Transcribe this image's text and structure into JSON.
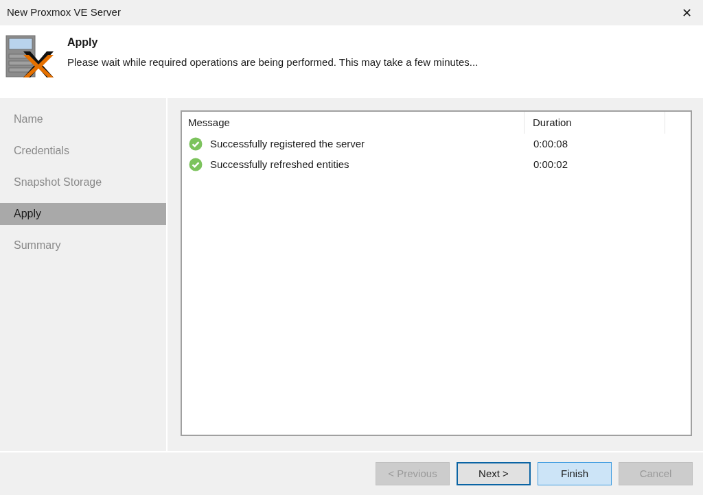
{
  "window": {
    "title": "New Proxmox VE Server",
    "close": "✕"
  },
  "header": {
    "title": "Apply",
    "description": "Please wait while required operations are being performed. This may take a few minutes..."
  },
  "sidebar": {
    "items": [
      {
        "label": "Name",
        "selected": false
      },
      {
        "label": "Credentials",
        "selected": false
      },
      {
        "label": "Snapshot Storage",
        "selected": false
      },
      {
        "label": "Apply",
        "selected": true
      },
      {
        "label": "Summary",
        "selected": false
      }
    ]
  },
  "table": {
    "columns": [
      "Message",
      "Duration"
    ],
    "rows": [
      {
        "kind": "success",
        "message": "Successfully registered the server",
        "duration": "0:00:08"
      },
      {
        "kind": "success",
        "message": "Successfully refreshed entities",
        "duration": "0:00:02"
      }
    ]
  },
  "buttons": [
    {
      "label": "< Previous",
      "disabled": true,
      "default": false,
      "highlighted": false
    },
    {
      "label": "Next >",
      "disabled": false,
      "default": true,
      "highlighted": false
    },
    {
      "label": "Finish",
      "disabled": false,
      "default": false,
      "highlighted": true
    },
    {
      "label": "Cancel",
      "disabled": true,
      "default": false,
      "highlighted": false
    }
  ]
}
